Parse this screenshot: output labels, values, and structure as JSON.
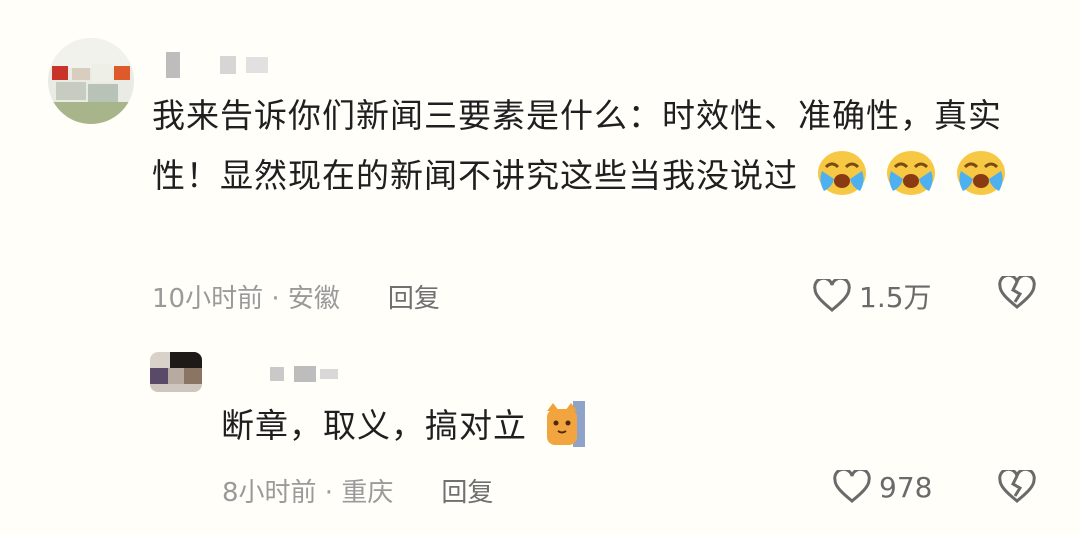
{
  "comments": [
    {
      "text": "我来告诉你们新闻三要素是什么：时效性、准确性，真实性！显然现在的新闻不讲究这些当我没说过",
      "emojis": [
        "crying-face",
        "crying-face",
        "crying-face"
      ],
      "time_location": "10小时前 · 安徽",
      "reply_label": "回复",
      "likes": "1.5万"
    },
    {
      "text": "断章，取义，搞对立",
      "emojis": [
        "cat-face"
      ],
      "time_location": "8小时前 · 重庆",
      "reply_label": "回复",
      "likes": "978"
    }
  ],
  "colors": {
    "text": "#1f1f1f",
    "meta": "#9a9a9a",
    "emoji": "#f7c843"
  }
}
